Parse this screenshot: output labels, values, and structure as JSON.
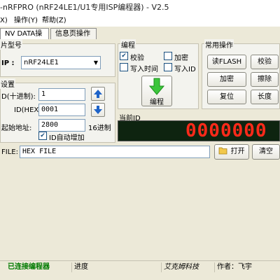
{
  "app": {
    "title": "-nRFPRO (nRF24LE1/U1专用ISP编程器)  - V2.5"
  },
  "menu": {
    "items": [
      "X)",
      "操作(Y)",
      "帮助(Z)"
    ]
  },
  "tabs": {
    "items": [
      "NV DATA操作",
      "信息页操作"
    ]
  },
  "chip": {
    "group_title": "片型号",
    "chip_label": "IP :",
    "chip_value": "nRF24LE1"
  },
  "settings": {
    "group_title": "设置",
    "id_count_label": "D(十进制):",
    "id_count_value": "1",
    "id_hex_label": "ID(HEX):",
    "id_hex_value": "0001",
    "start_addr_label": "起始地址:",
    "start_addr_value": "2800",
    "start_addr_unit": "16进制",
    "auto_increment_label": "ID自动增加",
    "auto_increment_checked": true
  },
  "program": {
    "group_title": "编程",
    "verify_label": "校验",
    "verify_checked": true,
    "encrypt_label": "加密",
    "encrypt_checked": false,
    "write_time_label": "写入时间",
    "write_time_checked": false,
    "write_id_label": "写入ID",
    "write_id_checked": false,
    "program_button_label": "编程"
  },
  "common_ops": {
    "group_title": "常用操作",
    "buttons": [
      "读FLASH",
      "校验",
      "加密",
      "擦除",
      "复位",
      "长度"
    ]
  },
  "current_id": {
    "label": "当前ID",
    "display": "0000000"
  },
  "file": {
    "label": "FILE:",
    "value": "HEX FILE",
    "open_button_label": "打开",
    "clear_button_label": "清空"
  },
  "status": {
    "connection": "已连接编程器",
    "progress_label": "进度",
    "company": "艾克姆科技",
    "author": "作者：飞宇",
    "connection_color": "#007a00"
  },
  "colors": {
    "accent_blue": "#1e63c8",
    "arrow_green": "#3cc63c",
    "led_bg": "#0e2410",
    "led_digit": "#ff2a1a"
  }
}
